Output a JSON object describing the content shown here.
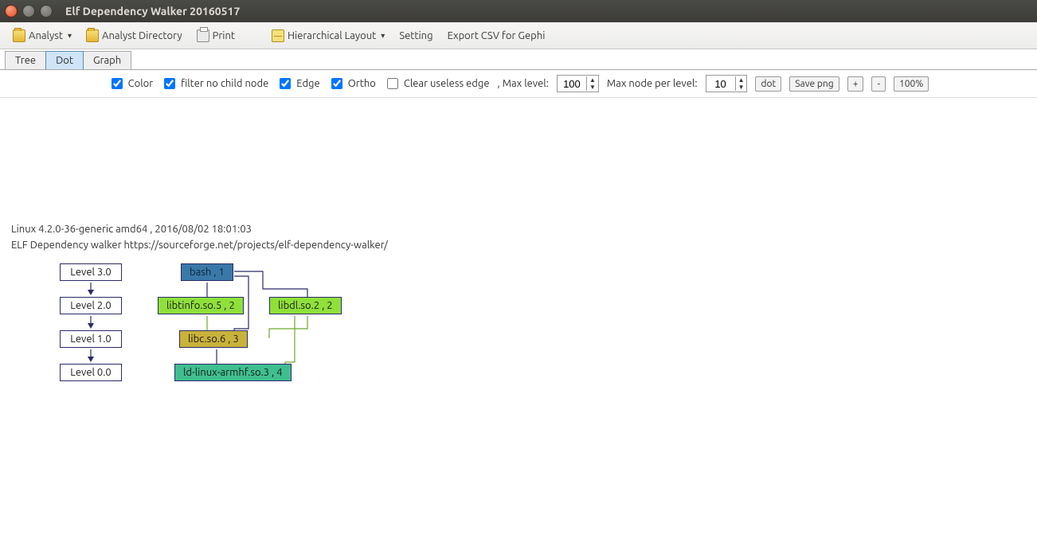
{
  "window": {
    "title": "Elf Dependency Walker 20160517"
  },
  "toolbar": {
    "analyst": "Analyst",
    "analyst_dir": "Analyst Directory",
    "print": "Print",
    "hier_layout": "Hierarchical Layout",
    "setting": "Setting",
    "export_csv": "Export CSV for Gephi"
  },
  "tabs": {
    "tree": "Tree",
    "dot": "Dot",
    "graph": "Graph"
  },
  "options": {
    "color": "Color",
    "filter": "filter no child node",
    "edge": "Edge",
    "ortho": "Ortho",
    "clear_edge": "Clear useless edge",
    "max_level_label": ", Max level:",
    "max_level_value": "100",
    "max_node_label": "Max node per level:",
    "max_node_value": "10",
    "dot_btn": "dot",
    "save_png": "Save png",
    "plus": "+",
    "minus": "-",
    "zoom": "100%"
  },
  "info": {
    "line1": "Linux 4.2.0-36-generic amd64 , 2016/08/02 18:01:03",
    "line2": "ELF Dependency walker https://sourceforge.net/projects/elf-dependency-walker/"
  },
  "levels": {
    "l3": "Level 3.0",
    "l2": "Level 2.0",
    "l1": "Level 1.0",
    "l0": "Level 0.0"
  },
  "nodes": {
    "bash": "bash , 1",
    "libtinfo": "libtinfo.so.5 , 2",
    "libdl": "libdl.so.2 , 2",
    "libc": "libc.so.6 , 3",
    "ldlinux": "ld-linux-armhf.so.3 , 4"
  },
  "colors": {
    "bash": "#3a78a8",
    "green_bright": "#8fe13a",
    "olive": "#c9b23a",
    "teal": "#3fbf8f"
  }
}
